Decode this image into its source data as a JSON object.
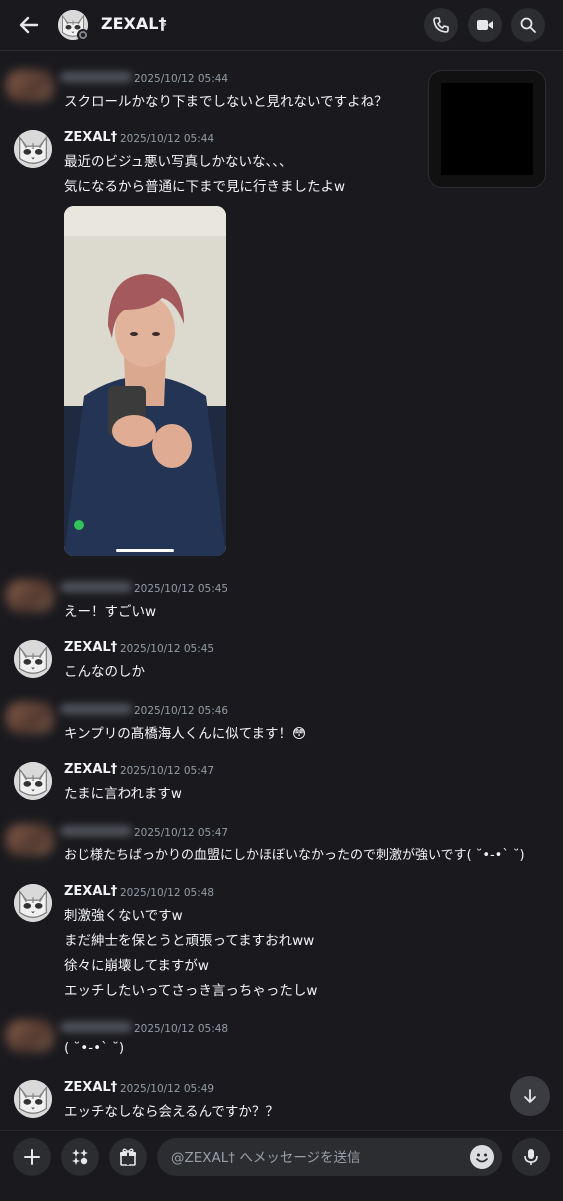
{
  "header": {
    "contact_name": "ZEXAL†",
    "chevron": "›",
    "icons": [
      "back-arrow-icon",
      "phone-icon",
      "video-camera-icon",
      "search-icon"
    ]
  },
  "messages": [
    {
      "author": "",
      "time": "2025/10/12 05:44",
      "lines": [
        "スクロールかなり下までしないと見れないですよね？"
      ]
    },
    {
      "author": "ZEXAL†",
      "time": "2025/10/12 05:44",
      "lines": [
        "最近のビジュ悪い写真しかないな、、、",
        "気になるから普通に下まで見に行きましたよw"
      ]
    },
    {
      "author": "",
      "time": "2025/10/12 05:45",
      "lines": [
        "えー！すごいw"
      ]
    },
    {
      "author": "ZEXAL†",
      "time": "2025/10/12 05:45",
      "lines": [
        "こんなのしか"
      ]
    },
    {
      "author": "",
      "time": "2025/10/12 05:46",
      "lines": [
        "キンプリの髙橋海人くんに似てます！😳"
      ]
    },
    {
      "author": "ZEXAL†",
      "time": "2025/10/12 05:47",
      "lines": [
        "たまに言われますw"
      ]
    },
    {
      "author": "",
      "time": "2025/10/12 05:47",
      "lines": [
        "おじ様たちばっかりの血盟にしかほぼいなかったので刺激が強いです( ˘•-•` ˘)"
      ]
    },
    {
      "author": "ZEXAL†",
      "time": "2025/10/12 05:48",
      "lines": [
        "刺激強くないですw",
        "まだ紳士を保とうと頑張ってますおれww",
        "徐々に崩壊してますがw",
        "エッチしたいってさっき言っちゃったしw"
      ]
    },
    {
      "author": "",
      "time": "2025/10/12 05:48",
      "lines": [
        "( ˘•-•` ˘)"
      ]
    },
    {
      "author": "ZEXAL†",
      "time": "2025/10/12 05:49",
      "lines": [
        "エッチなしなら会えるんですか？？"
      ]
    }
  ],
  "composer": {
    "placeholder": "@ZEXAL† へメッセージを送信",
    "icons": [
      "plus-icon",
      "apps-icon",
      "gift-icon",
      "emoji-icon",
      "microphone-icon"
    ]
  }
}
